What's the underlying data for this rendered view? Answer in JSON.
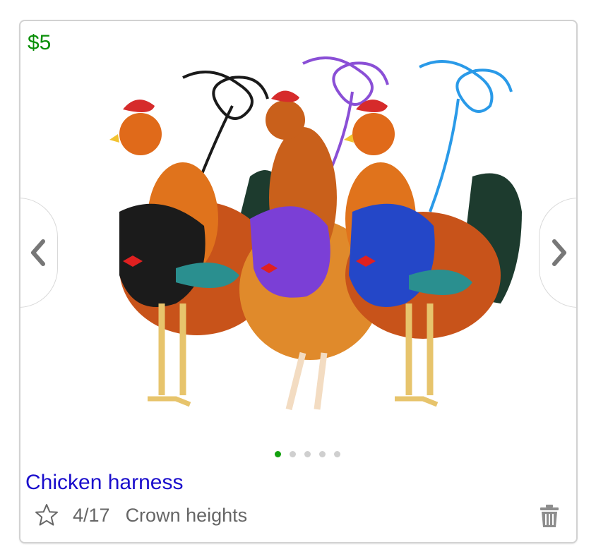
{
  "listing": {
    "price": "$5",
    "title": "Chicken harness",
    "date": "4/17",
    "location": "Crown heights"
  },
  "gallery": {
    "image_count": 5,
    "active_index": 0,
    "image_description": "Three roosters wearing black, purple and blue mesh harnesses with matching leashes"
  },
  "icons": {
    "prev": "chevron-left-icon",
    "next": "chevron-right-icon",
    "favorite": "star-outline-icon",
    "delete": "trash-icon"
  },
  "colors": {
    "price": "#0a8f08",
    "title_link": "#1a0dcc",
    "dot_active": "#13a10e",
    "dot_inactive": "#cfcfcf"
  }
}
